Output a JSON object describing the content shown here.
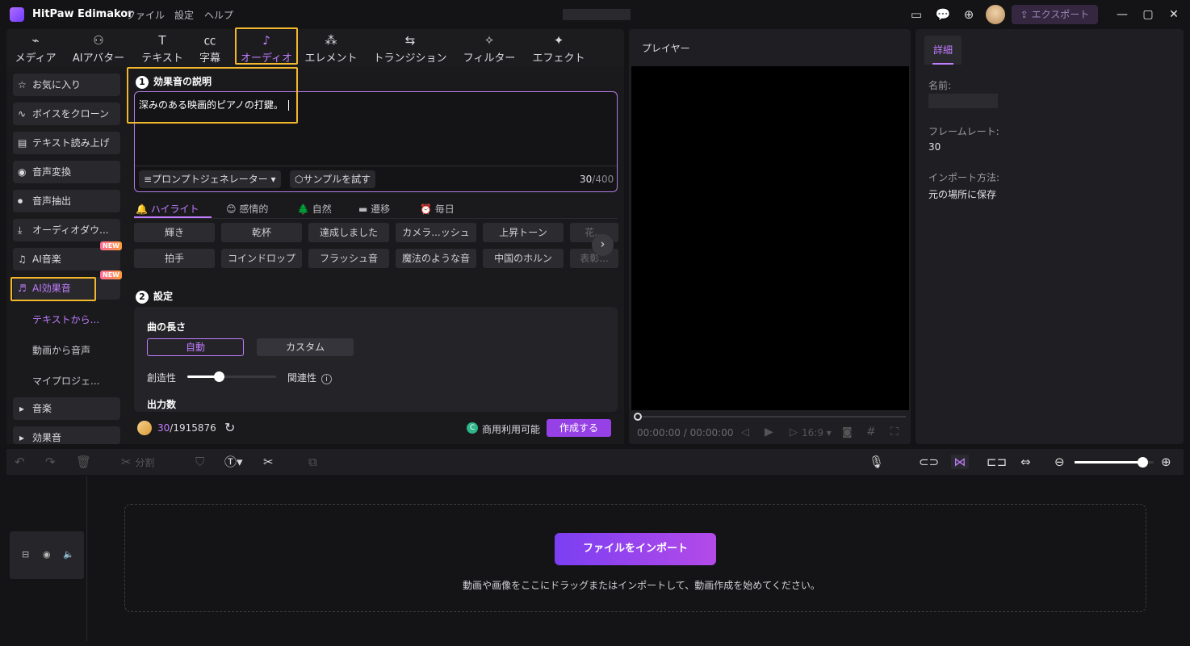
{
  "app": {
    "name": "HitPaw Edimakor",
    "menu": [
      "ファイル",
      "設定",
      "ヘルプ"
    ],
    "export_label": "エクスポート"
  },
  "tabs": [
    {
      "label": "メディア",
      "icon": "media-icon"
    },
    {
      "label": "AIアバター",
      "icon": "avatar-icon"
    },
    {
      "label": "テキスト",
      "icon": "text-icon"
    },
    {
      "label": "字幕",
      "icon": "subtitle-icon"
    },
    {
      "label": "オーディオ",
      "icon": "audio-icon",
      "active": true
    },
    {
      "label": "エレメント",
      "icon": "element-icon"
    },
    {
      "label": "トランジション",
      "icon": "transition-icon"
    },
    {
      "label": "フィルター",
      "icon": "filter-icon"
    },
    {
      "label": "エフェクト",
      "icon": "effect-icon"
    }
  ],
  "sidebar": {
    "items": [
      {
        "label": "お気に入り",
        "icon": "star-icon"
      },
      {
        "label": "ボイスをクローン",
        "icon": "waveform-icon"
      },
      {
        "label": "テキスト読み上げ",
        "icon": "tts-icon"
      },
      {
        "label": "音声変換",
        "icon": "voice-change-icon"
      },
      {
        "label": "音声抽出",
        "icon": "mic-icon"
      },
      {
        "label": "オーディオダウ...",
        "icon": "download-icon"
      },
      {
        "label": "AI音楽",
        "icon": "music-icon",
        "badge": "NEW"
      },
      {
        "label": "AI効果音",
        "icon": "sfx-icon",
        "badge": "NEW",
        "active": true
      }
    ],
    "sub_items": [
      "テキストから...",
      "動画から音声",
      "マイプロジェ..."
    ],
    "groups": [
      "音楽",
      "効果音"
    ]
  },
  "sfx": {
    "description_title": "効果音の説明",
    "step1": "1",
    "prompt_text": "深みのある映画的ピアノの打鍵。",
    "prompt_generator": "プロンプトジェネレーター",
    "try_sample": "サンプルを試す",
    "counter_current": "30",
    "counter_max": "/400",
    "categories": [
      {
        "label": "ハイライト",
        "icon": "bell-icon",
        "active": true
      },
      {
        "label": "感情的",
        "icon": "smile-icon"
      },
      {
        "label": "自然",
        "icon": "tree-icon"
      },
      {
        "label": "遷移",
        "icon": "transition-small-icon"
      },
      {
        "label": "毎日",
        "icon": "clock-icon"
      }
    ],
    "chips_row1": [
      "輝き",
      "乾杯",
      "達成しました",
      "カメラ...ッシュ",
      "上昇トーン",
      "花..."
    ],
    "chips_row2": [
      "拍手",
      "コインドロップ",
      "フラッシュ音",
      "魔法のような音",
      "中国のホルン",
      "表彰..."
    ],
    "step2": "2",
    "settings_title": "設定",
    "length_label": "曲の長さ",
    "length_auto": "自動",
    "length_custom": "カスタム",
    "creativity_label": "創造性",
    "creativity_value": 0.35,
    "relevance_label": "関連性",
    "output_count_label": "出力数",
    "credits_used": "30",
    "credits_total": "/1915876",
    "commercial_label": "商用利用可能",
    "create_label": "作成する"
  },
  "player": {
    "title": "プレイヤー",
    "time": "00:00:00 / 00:00:00",
    "ratio": "16:9"
  },
  "details": {
    "tab": "詳細",
    "name_label": "名前:",
    "framerate_label": "フレームレート:",
    "framerate_value": "30",
    "import_label": "インポート方法:",
    "import_value": "元の場所に保存"
  },
  "timeline": {
    "split_label": "分割",
    "import_button": "ファイルをインポート",
    "hint": "動画や画像をここにドラッグまたはインポートして、動画作成を始めてください。",
    "zoom": 0.86
  }
}
